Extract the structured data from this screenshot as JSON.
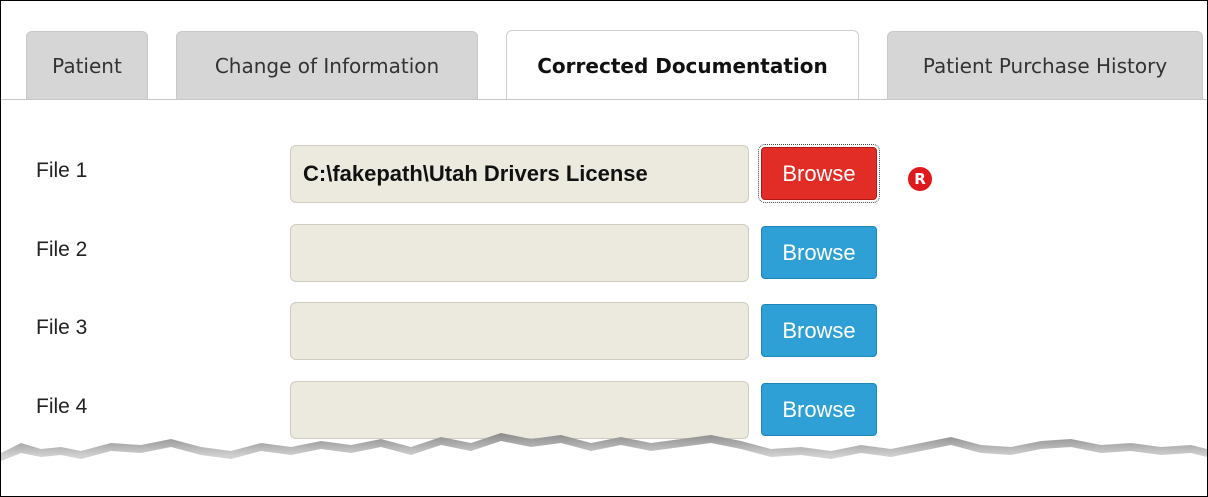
{
  "tabs": [
    {
      "label": "Patient",
      "active": false
    },
    {
      "label": "Change of Information",
      "active": false
    },
    {
      "label": "Corrected Documentation",
      "active": true
    },
    {
      "label": "Patient Purchase History",
      "active": false
    }
  ],
  "files": [
    {
      "label": "File 1",
      "value": "C:\\fakepath\\Utah Drivers License",
      "button": "Browse",
      "state": "error",
      "required_badge": "R"
    },
    {
      "label": "File 2",
      "value": "",
      "button": "Browse",
      "state": "normal"
    },
    {
      "label": "File 3",
      "value": "",
      "button": "Browse",
      "state": "normal"
    },
    {
      "label": "File 4",
      "value": "",
      "button": "Browse",
      "state": "normal"
    }
  ],
  "colors": {
    "browse_normal": "#2ea0d6",
    "browse_error": "#e22c26",
    "input_bg": "#eceadf",
    "tab_inactive": "#d6d6d6"
  }
}
